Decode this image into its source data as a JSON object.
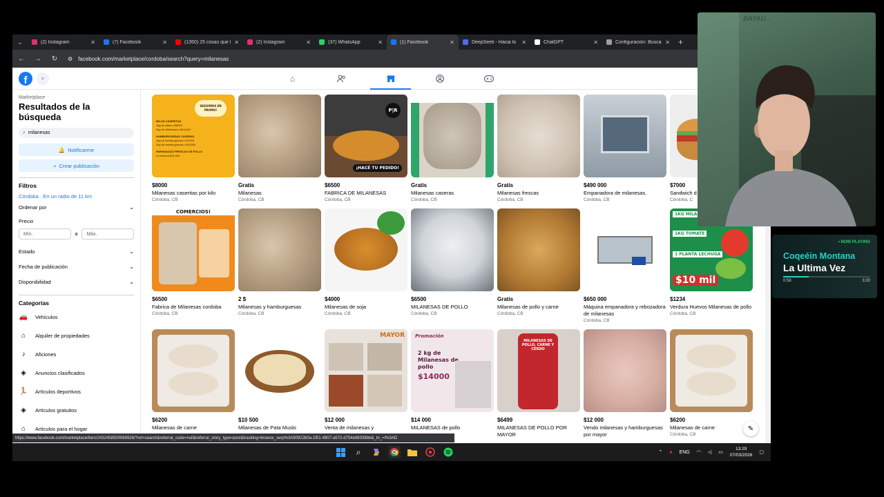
{
  "browser": {
    "tabs": [
      {
        "title": "(2) Instagram",
        "fav": "#e1306c",
        "active": false
      },
      {
        "title": "(7) Facebook",
        "fav": "#1877f2",
        "active": false
      },
      {
        "title": "(1350) 25 cosas que l",
        "fav": "#ff0000",
        "active": false
      },
      {
        "title": "(2) Instagram",
        "fav": "#e1306c",
        "active": false
      },
      {
        "title": "(37) WhatsApp",
        "fav": "#25d366",
        "active": false
      },
      {
        "title": "(1) Facebook",
        "fav": "#1877f2",
        "active": true
      },
      {
        "title": "DeepSeek - Hacia lo",
        "fav": "#4d6bfe",
        "active": false
      },
      {
        "title": "ChatGPT",
        "fav": "#ffffff",
        "active": false
      },
      {
        "title": "Configuración: Buscar",
        "fav": "#9aa0a6",
        "active": false
      }
    ],
    "url": "facebook.com/marketplace/cordoba/search?query=milanesas",
    "status_url": "https://www.facebook.com/marketplace/item/2432458500569926/?ref=search&referral_code=null&referral_story_type=post&tracking=browse_serp%3A90922b0a-1f51-4907-a572-d754e98338bb&_tn_=!%3AD"
  },
  "sidebar": {
    "section": "Marketplace",
    "title": "Resultados de la búsqueda",
    "search_value": "milanesas",
    "notify_label": "Notificarme",
    "create_label": "Crear publicación",
    "filters_heading": "Filtros",
    "location": "Córdoba · En un radio de 11 km",
    "sort_label": "Ordenar por",
    "price_label": "Precio",
    "min_placeholder": "Mín.",
    "max_placeholder": "Máx.",
    "price_sep": "a",
    "state_label": "Estado",
    "date_label": "Fecha de publicación",
    "availability_label": "Disponibilidad",
    "categories_heading": "Categorías",
    "categories": [
      {
        "label": "Vehículos",
        "icon": "car-icon"
      },
      {
        "label": "Alquiler de propiedades",
        "icon": "house-icon"
      },
      {
        "label": "Aficiones",
        "icon": "guitar-icon"
      },
      {
        "label": "Anuncios clasificados",
        "icon": "tag-icon"
      },
      {
        "label": "Artículos deportivos",
        "icon": "runner-icon"
      },
      {
        "label": "Artículos gratuitos",
        "icon": "tag-icon"
      },
      {
        "label": "Artículos para el hogar",
        "icon": "home-icon"
      }
    ]
  },
  "listings": [
    {
      "price": "$8000",
      "title": "Milanesas caseritas por kilo",
      "location": "Córdoba, CB",
      "img": "flyer-yellow"
    },
    {
      "price": "Gratis",
      "title": "Milanesas",
      "location": "Córdoba, CB",
      "img": "raw"
    },
    {
      "price": "$6500",
      "title": "FABRICA DE MILANESAS",
      "location": "Córdoba, CB",
      "img": "cooked-dark"
    },
    {
      "price": "Gratis",
      "title": "Milanesas caseras",
      "location": "Córdoba, CB",
      "img": "raw-green"
    },
    {
      "price": "Gratis",
      "title": "Milanesas frescas",
      "location": "Córdoba, CB",
      "img": "raw-light"
    },
    {
      "price": "$490 000",
      "title": "Empanadora de milanesas.",
      "location": "Córdoba, CB",
      "img": "machine"
    },
    {
      "price": "$7000",
      "title": "Sandwich d",
      "location": "Córdoba, C",
      "img": "sandwich"
    },
    {
      "price": "$6500",
      "title": "Fabrica de Milanesas cordoba",
      "location": "Córdoba, CB",
      "img": "flyer-orange"
    },
    {
      "price": "2 $",
      "title": "Milanesas y hamburguesas",
      "location": "Córdoba, CB",
      "img": "raw"
    },
    {
      "price": "$4000",
      "title": "Milanesas de soja",
      "location": "Córdoba, CB",
      "img": "cooked-plate"
    },
    {
      "price": "$6500",
      "title": "MILANESAS DE POLLO",
      "location": "Córdoba, CB",
      "img": "raw-white"
    },
    {
      "price": "Gratis",
      "title": "Milanesas de pollo y carne",
      "location": "Córdoba, CB",
      "img": "fried-pile"
    },
    {
      "price": "$650 000",
      "title": "Máquina empanadora y rebozadora de milanesas",
      "location": "Córdoba, CB",
      "img": "machine-white"
    },
    {
      "price": "$1234",
      "title": "Verdura Huevos Milanesas de pollo",
      "location": "Córdoba, CB",
      "img": "veg-flyer"
    },
    {
      "price": "$6200",
      "title": "Milanesas de carne",
      "location": "",
      "img": "box"
    },
    {
      "price": "$10 500",
      "title": "Milanesas de Pata Muslo",
      "location": "",
      "img": "board"
    },
    {
      "price": "$12 000",
      "title": "Venta de milanesas y",
      "location": "",
      "img": "collage"
    },
    {
      "price": "$14 000",
      "title": "MILANESAS de pollo",
      "location": "",
      "img": "flyer-pink"
    },
    {
      "price": "$6499",
      "title": "MILANESAS DE POLLO POR MAYOR",
      "location": "",
      "img": "hand-pack"
    },
    {
      "price": "$12 000",
      "title": "Vendo milanesas y hamburguesas por mayor",
      "location": "",
      "img": "raw-pink"
    },
    {
      "price": "$6200",
      "title": "Milanesas de carne",
      "location": "Córdoba, CB",
      "img": "box"
    }
  ],
  "thumb_text": {
    "flyer_yellow_top": "SEGUIMOS EN PROMO!",
    "flyer_yellow_1": "MILAS CASERITAS",
    "flyer_yellow_2": "1kg de milas x $8000",
    "flyer_yellow_3": "2kg de milanesas x $14.000",
    "flyer_yellow_4": "HAMBURGUESAS CASERAS",
    "flyer_yellow_5": "1kg de hamburguesas x $7000",
    "flyer_yellow_6": "2kg de hamburguesas x $13000",
    "flyer_yellow_7": "EMPANADAS FRESCAS DE POLLO",
    "flyer_yellow_8": "La docena $10.000",
    "pr_badge": "P|R",
    "hace_pedido": "¡HACÉ TU PEDIDO!",
    "comercios": "COMERCIOS!",
    "veg_1": "1KG MILA PECHUGA",
    "veg_2": "1KG TOMATE",
    "veg_3": "1 PLANTA LECHUGA",
    "veg_price": "$10 mil",
    "mayor": "MAYOR",
    "pink_promo": "Promoción",
    "pink_1": "2 kg de",
    "pink_2": "Milanesas de",
    "pink_3": "pollo",
    "pink_price": "$14000",
    "pack_text": "MILANESAS DE POLLO, CARNE Y CERDO"
  },
  "taskbar": {
    "lang": "ENG",
    "time": "13:29",
    "date": "07/03/2026"
  },
  "webcam": {
    "wall_text": "BAYAU..."
  },
  "now_playing": {
    "badge": "• NOW PLAYING",
    "artist": "Coqeéin Montana",
    "song": "La Ultima Vez",
    "elapsed": "0:58",
    "duration": "3:20",
    "progress": 0.29
  },
  "colors": {
    "fb_blue": "#1877f2",
    "accent_teal": "#28d0c4"
  }
}
